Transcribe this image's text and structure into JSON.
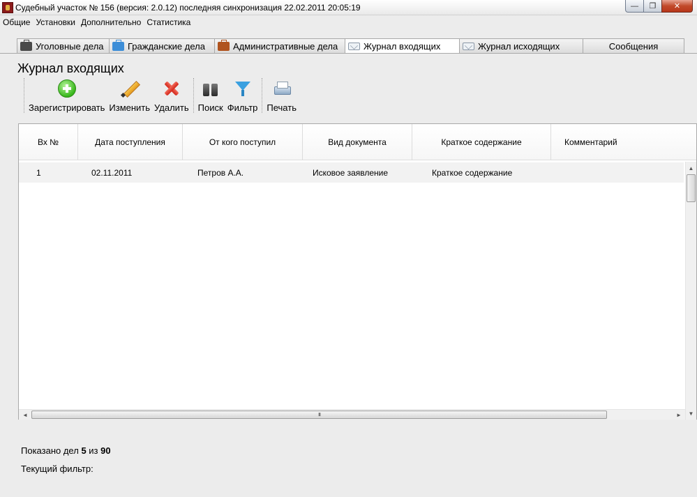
{
  "window": {
    "title": "Судебный участок № 156 (версия: 2.0.12) последняя синхронизация 22.02.2011 20:05:19",
    "minimize_glyph": "—",
    "maximize_glyph": "❐",
    "close_glyph": "✕"
  },
  "menu": {
    "items": [
      "Общие",
      "Установки",
      "Дополнительно",
      "Статистика"
    ]
  },
  "tabs": [
    {
      "label": "Уголовные дела",
      "icon": "briefcase-dark-icon",
      "active": false
    },
    {
      "label": "Гражданские дела",
      "icon": "briefcase-blue-icon",
      "active": false
    },
    {
      "label": "Административные дела",
      "icon": "briefcase-brown-icon",
      "active": false
    },
    {
      "label": "Журнал входящих",
      "icon": "envelope-icon",
      "active": true
    },
    {
      "label": "Журнал исходящих",
      "icon": "envelope-icon",
      "active": false
    },
    {
      "label": "Сообщения",
      "icon": "",
      "active": false
    }
  ],
  "page": {
    "title": "Журнал входящих"
  },
  "toolbar": {
    "register_label": "Зарегистрировать",
    "edit_label": "Изменить",
    "delete_label": "Удалить",
    "search_label": "Поиск",
    "filter_label": "Фильтр",
    "print_label": "Печать"
  },
  "table": {
    "columns": [
      "Вх №",
      "Дата поступления",
      "От кого поступил",
      "Вид документа",
      "Краткое содержание",
      "Комментарий"
    ],
    "rows": [
      [
        "1",
        "02.11.2011",
        "Петров А.А.",
        "Исковое заявление",
        "Краткое содержание",
        ""
      ]
    ]
  },
  "scrollbars": {
    "up_glyph": "▲",
    "down_glyph": "▼",
    "left_glyph": "◄",
    "right_glyph": "►",
    "grip_glyph": "III"
  },
  "footer": {
    "count_prefix": "Показано дел",
    "shown": "5",
    "count_of": "из",
    "total": "90",
    "filter_label": "Текущий фильтр:"
  },
  "colors": {
    "window_bg": "#ececec",
    "close_button": "#c14a2b",
    "row_highlight": "#f2f2f2"
  }
}
